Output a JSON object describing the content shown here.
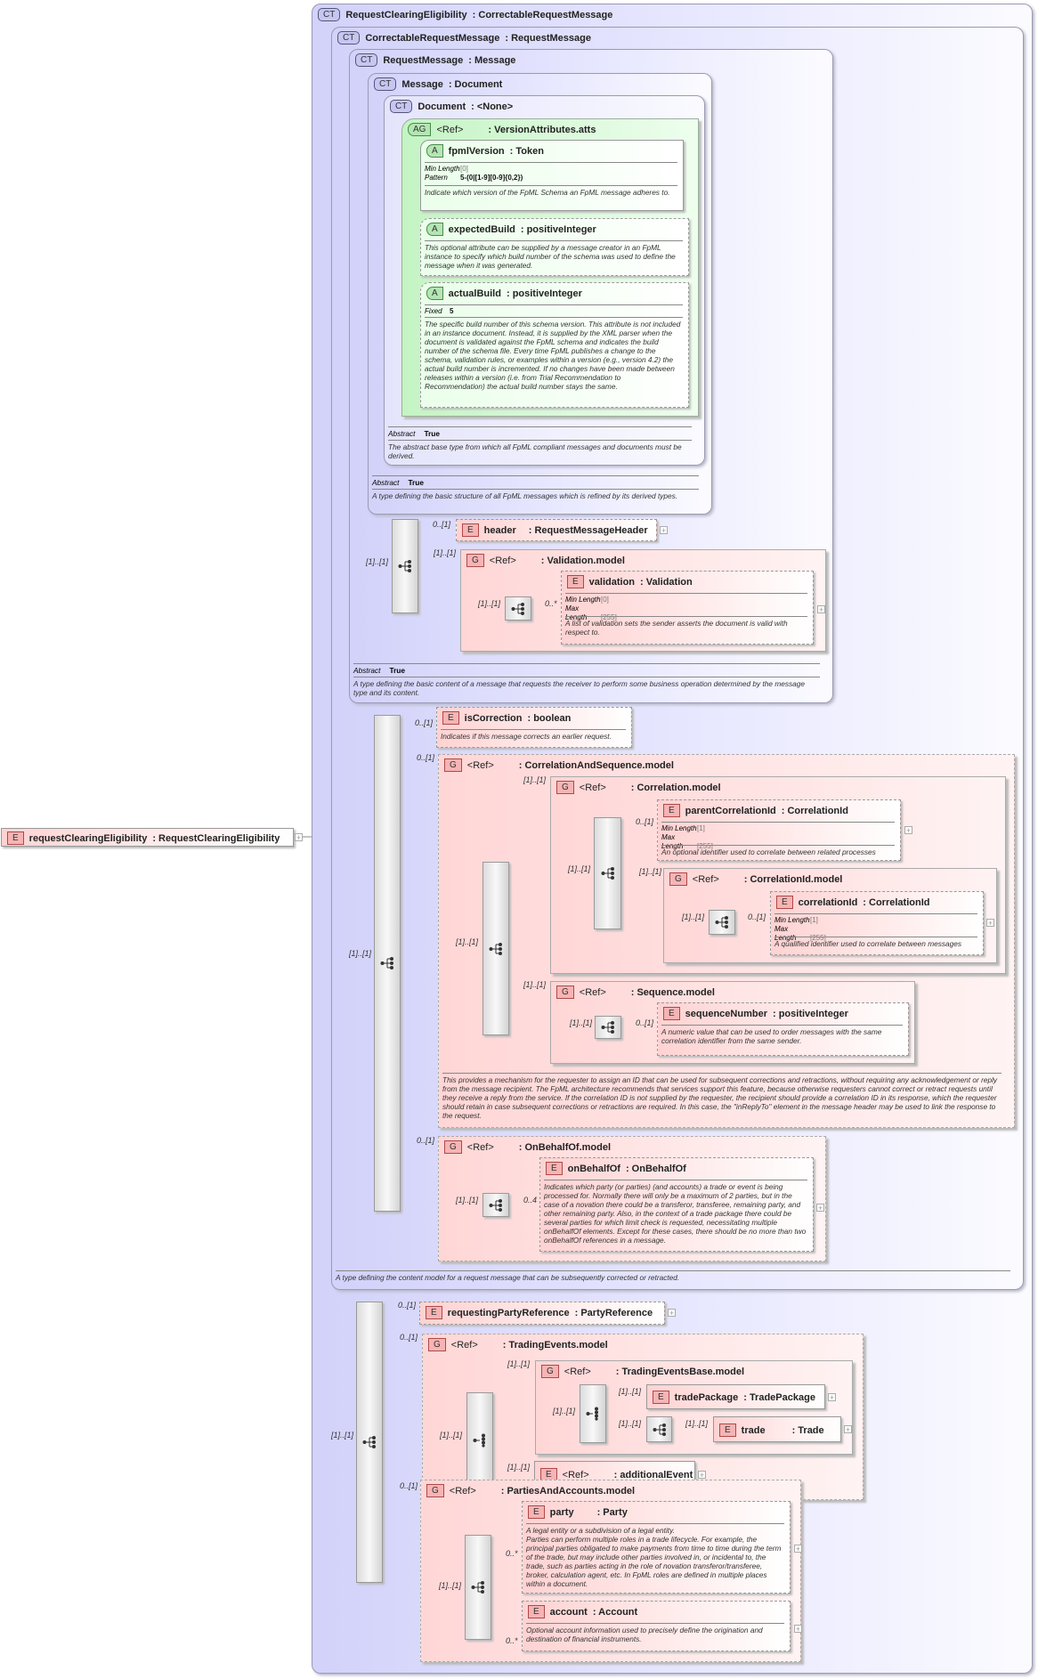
{
  "root": {
    "badge": "E",
    "name": "requestClearingEligibility",
    "type": ": RequestClearingEligibility"
  },
  "ct1": {
    "badge": "CT",
    "name": "RequestClearingEligibility",
    "type": ": CorrectableRequestMessage"
  },
  "ct2": {
    "badge": "CT",
    "name": "CorrectableRequestMessage",
    "type": ": RequestMessage",
    "description": "A type defining the content model for a request message that can be subsequently corrected or retracted."
  },
  "ct3": {
    "badge": "CT",
    "name": "RequestMessage",
    "type": ": Message",
    "abstract_label": "Abstract",
    "abstract_value": "True",
    "description": "A type defining the basic content of a message that requests the receiver to perform some business operation determined by the message type and its content."
  },
  "ct4": {
    "badge": "CT",
    "name": "Message",
    "type": ": Document",
    "abstract_label": "Abstract",
    "abstract_value": "True",
    "description": "A type defining the basic structure of all FpML messages which is refined by its derived types."
  },
  "ct5": {
    "badge": "CT",
    "name": "Document",
    "type": ": <None>",
    "abstract_label": "Abstract",
    "abstract_value": "True",
    "description": "The abstract base type from which all FpML compliant messages and documents must be derived."
  },
  "ag": {
    "badge": "AG",
    "name": "<Ref>",
    "type": ": VersionAttributes.atts"
  },
  "fpmlVersion": {
    "badge": "A",
    "name": "fpmlVersion",
    "type": ": Token",
    "props": [
      {
        "k": "Min Length",
        "v": "[0]"
      },
      {
        "k": "Pattern",
        "v": "5-(0|[1-9][0-9]{0,2})"
      }
    ],
    "description": "Indicate which version of the FpML Schema an FpML message adheres to."
  },
  "expectedBuild": {
    "badge": "A",
    "name": "expectedBuild",
    "type": ": positiveInteger",
    "description": "This optional attribute can be supplied by a message creator in an FpML instance to specify which build number of the schema was used to define the message when it was generated."
  },
  "actualBuild": {
    "badge": "A",
    "name": "actualBuild",
    "type": ": positiveInteger",
    "props": [
      {
        "k": "Fixed",
        "v": "5"
      }
    ],
    "description": "The specific build number of this schema version. This attribute is not included in an instance document. Instead, it is supplied by the XML parser when the document is validated against the FpML schema and indicates the build number of the schema file. Every time FpML publishes a change to the schema, validation rules, or examples within a version (e.g., version 4.2) the actual build number is incremented. If no changes have been made between releases within a version (i.e. from Trial Recommendation to Recommendation) the actual build number stays the same."
  },
  "header": {
    "badge": "E",
    "name": "header",
    "type": ": RequestMessageHeader"
  },
  "validation_model": {
    "badge": "G",
    "name": "<Ref>",
    "type": ": Validation.model"
  },
  "validation": {
    "badge": "E",
    "name": "validation",
    "type": ": Validation",
    "props": [
      {
        "k": "Min Length",
        "v": "[0]"
      },
      {
        "k": "Max Length",
        "v": "[255]"
      }
    ],
    "description": "A list of validation sets the sender asserts the document is valid with respect to."
  },
  "isCorrection": {
    "badge": "E",
    "name": "isCorrection",
    "type": ": boolean",
    "description": "Indicates if this message corrects an earlier request."
  },
  "corrseq_model": {
    "badge": "G",
    "name": "<Ref>",
    "type": ": CorrelationAndSequence.model",
    "description": "This provides a mechanism for the requester to assign an ID that can be used for subsequent corrections and retractions, without requiring any acknowledgement or reply from the message recipient. The FpML architecture recommends that services support this feature, because otherwise requesters cannot correct or retract requests until they receive a reply from the service. If the correlation ID is not supplied by the requester, the recipient should provide a correlation ID in its response, which the requester should retain in case subsequent corrections or retractions are required. In this case, the \"inReplyTo\" element in the message header may be used to link the response to the request."
  },
  "correlation_model": {
    "badge": "G",
    "name": "<Ref>",
    "type": ": Correlation.model"
  },
  "parentCorrelationId": {
    "badge": "E",
    "name": "parentCorrelationId",
    "type": ": CorrelationId",
    "props": [
      {
        "k": "Min Length",
        "v": "[1]"
      },
      {
        "k": "Max Length",
        "v": "[255]"
      }
    ],
    "description": "An optional identifier used to correlate between related processes"
  },
  "correlationId_model": {
    "badge": "G",
    "name": "<Ref>",
    "type": ": CorrelationId.model"
  },
  "correlationId": {
    "badge": "E",
    "name": "correlationId",
    "type": ": CorrelationId",
    "props": [
      {
        "k": "Min Length",
        "v": "[1]"
      },
      {
        "k": "Max Length",
        "v": "[255]"
      }
    ],
    "description": "A qualified identifier used to correlate between messages"
  },
  "sequence_model": {
    "badge": "G",
    "name": "<Ref>",
    "type": ": Sequence.model"
  },
  "sequenceNumber": {
    "badge": "E",
    "name": "sequenceNumber",
    "type": ": positiveInteger",
    "description": "A numeric value that can be used to order messages with the same correlation identifier from the same sender."
  },
  "onBehalfOf_model": {
    "badge": "G",
    "name": "<Ref>",
    "type": ": OnBehalfOf.model"
  },
  "onBehalfOf": {
    "badge": "E",
    "name": "onBehalfOf",
    "type": ": OnBehalfOf",
    "description": "Indicates which party (or parties) (and accounts) a trade or event is being processed for. Normally there will only be a maximum of 2 parties, but in the case of a novation there could be a transferor, transferee, remaining party, and other remaining party. Also, in the context of a trade package there could be several parties for which limit check is requested, necessitating multiple onBehalfOf elements. Except for these cases, there should be no more than two onBehalfOf references in a message."
  },
  "requestingPartyReference": {
    "badge": "E",
    "name": "requestingPartyReference",
    "type": ": PartyReference"
  },
  "tradingEvents_model": {
    "badge": "G",
    "name": "<Ref>",
    "type": ": TradingEvents.model"
  },
  "tradingEventsBase_model": {
    "badge": "G",
    "name": "<Ref>",
    "type": ": TradingEventsBase.model"
  },
  "tradePackage": {
    "badge": "E",
    "name": "tradePackage",
    "type": ": TradePackage"
  },
  "trade": {
    "badge": "E",
    "name": "trade",
    "type": ": Trade"
  },
  "additionalEvent": {
    "badge": "E",
    "name": "<Ref>",
    "type": ": additionalEvent"
  },
  "partiesAccounts_model": {
    "badge": "G",
    "name": "<Ref>",
    "type": ": PartiesAndAccounts.model"
  },
  "party": {
    "badge": "E",
    "name": "party",
    "type": ": Party",
    "description": "A legal entity or a subdivision of a legal entity.\nParties can perform multiple roles in a trade lifecycle. For example, the principal parties obligated to make payments from time to time during the term of the trade, but may include other parties involved in, or incidental to, the trade, such as parties acting in the role of novation transferor/transferee, broker, calculation agent, etc. In FpML roles are defined in multiple places within a document."
  },
  "account": {
    "badge": "E",
    "name": "account",
    "type": ": Account",
    "description": "Optional account information used to precisely define the origination and destination of financial instruments."
  },
  "occurs": {
    "one": "[1]..[1]",
    "opt": "0..[1]",
    "many": "0..*",
    "four": "0..4"
  },
  "expand": "+",
  "colors": {
    "complex_type": "#d2d2fa",
    "element": "#ffd2d2",
    "attribute_group": "#c4f4c4"
  }
}
